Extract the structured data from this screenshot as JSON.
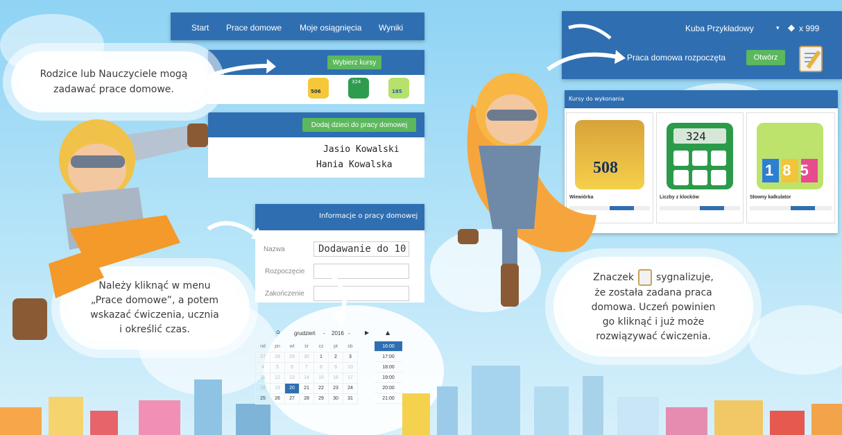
{
  "left_app": {
    "nav": [
      "Start",
      "Prace domowe",
      "Moje osiągnięcia",
      "Wyniki"
    ],
    "choose_courses_button": "Wybierz kursy",
    "add_children_button": "Dodaj dzieci do pracy domowej",
    "children": [
      "Jasio Kowalski",
      "Hania Kowalska"
    ],
    "info_header": "Informacje o pracy domowej",
    "form": {
      "name_label": "Nazwa",
      "name_value": "Dodawanie do 10",
      "start_label": "Rozpoczęcie",
      "end_label": "Zakończenie"
    },
    "course_icons": [
      "506",
      "324",
      "185"
    ]
  },
  "calendar": {
    "month": "grudzień",
    "year": "2016",
    "weekdays": [
      "nd",
      "pn",
      "wt",
      "śr",
      "cz",
      "pt",
      "sb"
    ],
    "weeks": [
      [
        "27",
        "28",
        "29",
        "30",
        "1",
        "2",
        "3"
      ],
      [
        "4",
        "5",
        "6",
        "7",
        "8",
        "9",
        "10"
      ],
      [
        "11",
        "12",
        "13",
        "14",
        "15",
        "16",
        "17"
      ],
      [
        "18",
        "19",
        "20",
        "21",
        "22",
        "23",
        "24"
      ],
      [
        "25",
        "26",
        "27",
        "28",
        "29",
        "30",
        "31"
      ]
    ],
    "selected_day": "20",
    "times": [
      "16:00",
      "17:00",
      "18:00",
      "19:00",
      "20:00",
      "21:00"
    ],
    "selected_time": "16:00"
  },
  "right_app": {
    "user": "Kuba Przykładowy",
    "gems": "x 999",
    "homework_started": "Praca domowa rozpoczęta",
    "open_button": "Otwórz",
    "courses_header": "Kursy do wykonania",
    "courses": [
      {
        "title": "Wiewiórka",
        "number": "508"
      },
      {
        "title": "Liczby z klocków",
        "number": "324"
      },
      {
        "title": "Słowny kalkulator",
        "number": "185"
      }
    ]
  },
  "bubbles": {
    "top_left": [
      "Rodzice lub Nauczyciele mogą",
      "zadawać prace domowe."
    ],
    "bottom_left": [
      "Należy kliknąć w menu",
      "„Prace domowe”, a potem",
      "wskazać ćwiczenia, ucznia",
      "i określić czas."
    ],
    "right_prefix": "Znaczek",
    "right_suffix": "sygnalizuje,",
    "right_lines": [
      "że została zadana praca",
      "domowa. Uczeń powinien",
      "go kliknąć i już może",
      "rozwiązywać ćwiczenia."
    ]
  },
  "colors": {
    "panel_blue": "#2f6fb1",
    "button_green": "#5cb85c",
    "sky": "#9cd8f5"
  }
}
